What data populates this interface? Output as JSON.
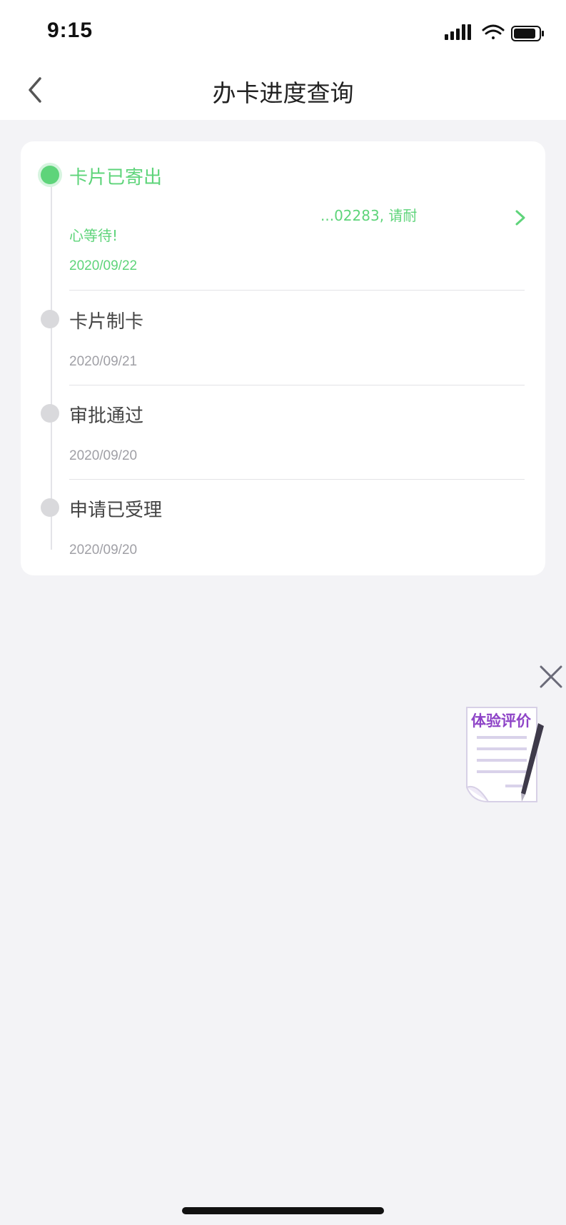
{
  "status_bar": {
    "time": "9:15"
  },
  "header": {
    "title": "办卡进度查询"
  },
  "timeline": [
    {
      "title": "卡片已寄出",
      "description_line1": "...02283, 请耐",
      "description_line2": "心等待!",
      "date": "2020/09/22",
      "active": true
    },
    {
      "title": "卡片制卡",
      "date": "2020/09/21",
      "active": false
    },
    {
      "title": "审批通过",
      "date": "2020/09/20",
      "active": false
    },
    {
      "title": "申请已受理",
      "date": "2020/09/20",
      "active": false
    }
  ],
  "floating": {
    "label": "体验评价"
  },
  "colors": {
    "accent": "#5ed47a",
    "background": "#f3f3f6",
    "inactive_dot": "#d9d9dc",
    "badge_text": "#8e44c7"
  }
}
